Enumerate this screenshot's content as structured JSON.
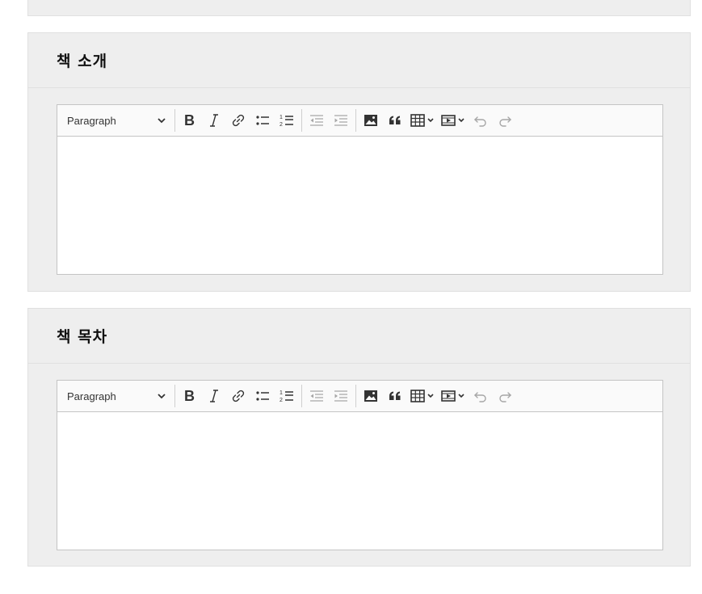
{
  "sections": [
    {
      "title": "책 소개"
    },
    {
      "title": "책 목차"
    }
  ],
  "toolbar": {
    "heading_value": "Paragraph",
    "buttons": [
      "Bold",
      "Italic",
      "Link",
      "Bulleted List",
      "Numbered List",
      "Decrease indent",
      "Increase indent",
      "Insert image",
      "Block quote",
      "Insert table",
      "Insert media",
      "Undo",
      "Redo"
    ]
  },
  "colors": {
    "card_bg": "#eeeeee",
    "editor_border": "#c4c4c4",
    "toolbar_bg": "#fafafa"
  }
}
